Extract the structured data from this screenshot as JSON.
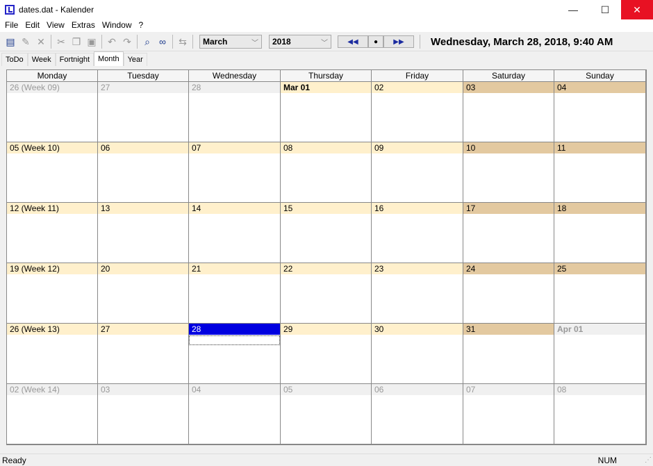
{
  "window": {
    "title": "dates.dat - Kalender",
    "minimize": "—",
    "maximize": "☐",
    "close": "✕"
  },
  "menu": [
    "File",
    "Edit",
    "View",
    "Extras",
    "Window",
    "?"
  ],
  "toolbar": {
    "icons": [
      "calendar-icon",
      "edit-icon",
      "delete-icon",
      "cut-icon",
      "copy-icon",
      "paste-icon",
      "undo-icon",
      "redo-icon",
      "find-icon",
      "view-icon",
      "swap-icon"
    ],
    "month": "March",
    "year": "2018",
    "prev": "◀◀",
    "today": "●",
    "next": "▶▶",
    "now": "Wednesday, March 28, 2018, 9:40 AM"
  },
  "tabs": [
    {
      "label": "ToDo"
    },
    {
      "label": "Week"
    },
    {
      "label": "Fortnight"
    },
    {
      "label": "Month",
      "active": true
    },
    {
      "label": "Year"
    }
  ],
  "calendar": {
    "days": [
      "Monday",
      "Tuesday",
      "Wednesday",
      "Thursday",
      "Friday",
      "Saturday",
      "Sunday"
    ],
    "colors": {
      "weekday": "#fff0cc",
      "weekend": "#e3c9a0",
      "other": "#f0f0f0",
      "selected": "#0000e0"
    },
    "weeks": [
      [
        {
          "l": "26 (Week 09)",
          "t": "oth"
        },
        {
          "l": "27",
          "t": "oth"
        },
        {
          "l": "28",
          "t": "oth"
        },
        {
          "l": "Mar 01",
          "t": "wk",
          "b": true
        },
        {
          "l": "02",
          "t": "wk"
        },
        {
          "l": "03",
          "t": "we"
        },
        {
          "l": "04",
          "t": "we"
        }
      ],
      [
        {
          "l": "05 (Week 10)",
          "t": "wk"
        },
        {
          "l": "06",
          "t": "wk"
        },
        {
          "l": "07",
          "t": "wk"
        },
        {
          "l": "08",
          "t": "wk"
        },
        {
          "l": "09",
          "t": "wk"
        },
        {
          "l": "10",
          "t": "we"
        },
        {
          "l": "11",
          "t": "we"
        }
      ],
      [
        {
          "l": "12 (Week 11)",
          "t": "wk"
        },
        {
          "l": "13",
          "t": "wk"
        },
        {
          "l": "14",
          "t": "wk"
        },
        {
          "l": "15",
          "t": "wk"
        },
        {
          "l": "16",
          "t": "wk"
        },
        {
          "l": "17",
          "t": "we"
        },
        {
          "l": "18",
          "t": "we"
        }
      ],
      [
        {
          "l": "19 (Week 12)",
          "t": "wk"
        },
        {
          "l": "20",
          "t": "wk"
        },
        {
          "l": "21",
          "t": "wk"
        },
        {
          "l": "22",
          "t": "wk"
        },
        {
          "l": "23",
          "t": "wk"
        },
        {
          "l": "24",
          "t": "we"
        },
        {
          "l": "25",
          "t": "we"
        }
      ],
      [
        {
          "l": "26 (Week 13)",
          "t": "wk"
        },
        {
          "l": "27",
          "t": "wk"
        },
        {
          "l": "28",
          "t": "sel"
        },
        {
          "l": "29",
          "t": "wk"
        },
        {
          "l": "30",
          "t": "wk"
        },
        {
          "l": "31",
          "t": "we"
        },
        {
          "l": "Apr 01",
          "t": "oth",
          "b": true
        }
      ],
      [
        {
          "l": "02 (Week 14)",
          "t": "oth"
        },
        {
          "l": "03",
          "t": "oth"
        },
        {
          "l": "04",
          "t": "oth"
        },
        {
          "l": "05",
          "t": "oth"
        },
        {
          "l": "06",
          "t": "oth"
        },
        {
          "l": "07",
          "t": "oth"
        },
        {
          "l": "08",
          "t": "oth"
        }
      ]
    ]
  },
  "status": {
    "text": "Ready",
    "num": "NUM"
  }
}
